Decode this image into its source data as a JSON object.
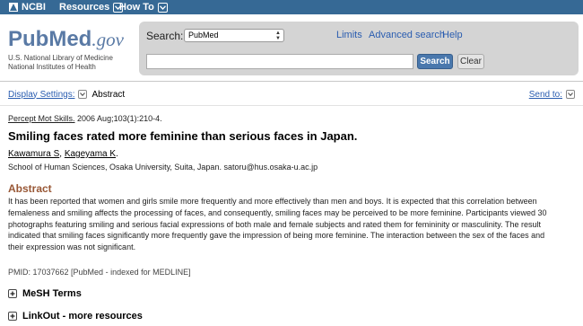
{
  "topbar": {
    "logo": "NCBI",
    "menu": [
      {
        "label": "Resources"
      },
      {
        "label": "How To"
      }
    ]
  },
  "logo": {
    "pub": "Pub",
    "med": "Med",
    "gov": ".gov",
    "line1": "U.S. National Library of Medicine",
    "line2": "National Institutes of Health"
  },
  "search": {
    "label": "Search:",
    "database": "PubMed",
    "query": "",
    "search_button": "Search",
    "clear_button": "Clear",
    "links": [
      "Limits",
      "Advanced search",
      "Help"
    ]
  },
  "display": {
    "settings_label": "Display Settings:",
    "format": "Abstract",
    "send_to": "Send to:"
  },
  "article": {
    "journal": "Percept Mot Skills.",
    "citation_rest": " 2006 Aug;103(1):210-4.",
    "title": "Smiling faces rated more feminine than serious faces in Japan.",
    "authors": [
      "Kawamura S",
      "Kageyama K"
    ],
    "author_sep": ", ",
    "author_end": ".",
    "affiliation": "School of Human Sciences, Osaka University, Suita, Japan. satoru@hus.osaka-u.ac.jp",
    "abstract_heading": "Abstract",
    "abstract_lines": [
      "It has been reported that women and girls smile more frequently and more effectively than men and boys. It is expected that this correlation between",
      "femaleness and smiling affects the processing of faces, and consequently, smiling faces may be perceived to be more feminine. Participants viewed 30",
      "photographs featuring smiling and serious facial expressions of both male and female subjects and rated them for femininity or masculinity. The result",
      "indicated that smiling faces significantly more frequently gave the impression of being more feminine. The interaction between the sex of the faces and",
      "their expression was not significant."
    ],
    "pmid": "PMID: 17037662 [PubMed - indexed for MEDLINE]"
  },
  "expanders": [
    {
      "label": "MeSH Terms"
    },
    {
      "label": "LinkOut - more resources"
    }
  ],
  "colors": {
    "topbar": "#366995",
    "link": "#2a5db0",
    "abstract_heading": "#985735"
  }
}
